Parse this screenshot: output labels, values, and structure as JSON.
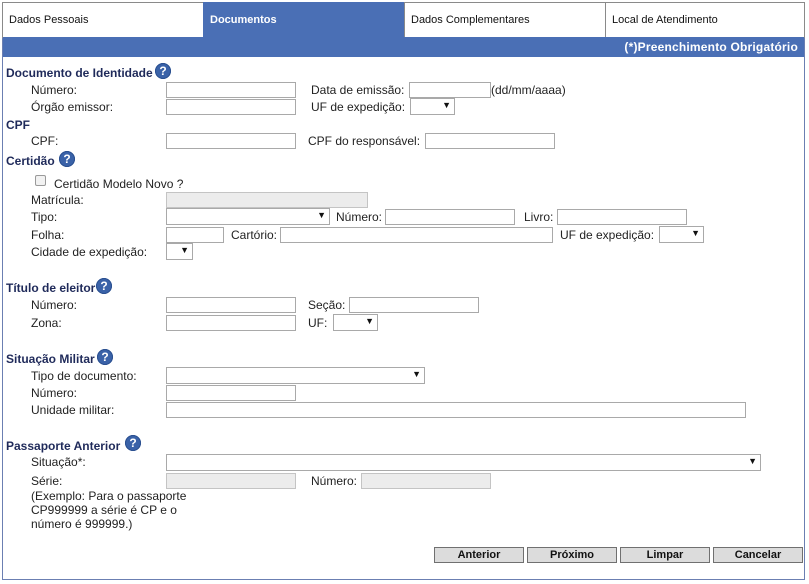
{
  "tabs": [
    {
      "label": "Dados Pessoais"
    },
    {
      "label": "Documentos"
    },
    {
      "label": "Dados Complementares"
    },
    {
      "label": "Local de Atendimento"
    }
  ],
  "required_notice": "(*)Preenchimento Obrigatório",
  "help_glyph": "?",
  "identidade": {
    "title": "Documento de Identidade",
    "numero_label": "Número:",
    "data_emissao_label": "Data de emissão:",
    "date_format_hint": "(dd/mm/aaaa)",
    "orgao_label": "Órgão emissor:",
    "uf_label": "UF de expedição:"
  },
  "cpf": {
    "title": "CPF",
    "cpf_label": "CPF:",
    "responsavel_label": "CPF do responsável:"
  },
  "certidao": {
    "title": "Certidão",
    "modelo_novo_label": "Certidão Modelo Novo ?",
    "modelo_novo_checked": false,
    "matricula_label": "Matrícula:",
    "tipo_label": "Tipo:",
    "numero_label": "Número:",
    "livro_label": "Livro:",
    "folha_label": "Folha:",
    "cartorio_label": "Cartório:",
    "uf_label": "UF de expedição:",
    "cidade_label": "Cidade de expedição:"
  },
  "titulo_eleitor": {
    "title": "Título de eleitor",
    "numero_label": "Número:",
    "secao_label": "Seção:",
    "zona_label": "Zona:",
    "uf_label": "UF:"
  },
  "situacao_militar": {
    "title": "Situação Militar",
    "tipo_label": "Tipo de documento:",
    "numero_label": "Número:",
    "unidade_label": "Unidade militar:"
  },
  "passaporte": {
    "title": "Passaporte Anterior",
    "situacao_label": "Situação*:",
    "serie_label": "Série:",
    "numero_label": "Número:",
    "example": "(Exemplo: Para o passaporte CP999999 a série é CP e o número é 999999.)"
  },
  "buttons": {
    "anterior": "Anterior",
    "proximo": "Próximo",
    "limpar": "Limpar",
    "cancelar": "Cancelar"
  },
  "colors": {
    "accent": "#4a6fb5",
    "section_title": "#1f2a5a",
    "help_icon": "#3a62a8"
  }
}
